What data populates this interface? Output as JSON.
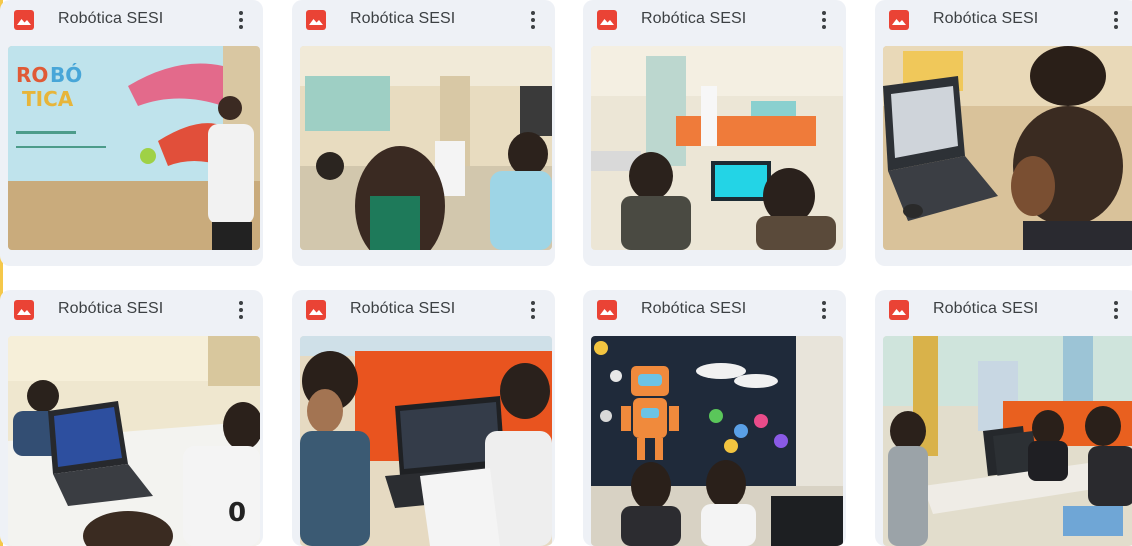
{
  "files": [
    {
      "title": "Robótica SESI",
      "menu_icon": "more-vert-icon",
      "type_icon": "image-file-icon",
      "scene": "presenter-projection"
    },
    {
      "title": "Robótica SESI",
      "menu_icon": "more-vert-icon",
      "type_icon": "image-file-icon",
      "scene": "audience-room"
    },
    {
      "title": "Robótica SESI",
      "menu_icon": "more-vert-icon",
      "type_icon": "image-file-icon",
      "scene": "students-laptops-room"
    },
    {
      "title": "Robótica SESI",
      "menu_icon": "more-vert-icon",
      "type_icon": "image-file-icon",
      "scene": "student-closeup-laptop"
    },
    {
      "title": "Robótica SESI",
      "menu_icon": "more-vert-icon",
      "type_icon": "image-file-icon",
      "scene": "kids-at-table-laptop"
    },
    {
      "title": "Robótica SESI",
      "menu_icon": "more-vert-icon",
      "type_icon": "image-file-icon",
      "scene": "boys-orange-wall"
    },
    {
      "title": "Robótica SESI",
      "menu_icon": "more-vert-icon",
      "type_icon": "image-file-icon",
      "scene": "robot-board-girls"
    },
    {
      "title": "Robótica SESI",
      "menu_icon": "more-vert-icon",
      "type_icon": "image-file-icon",
      "scene": "kids-laptops-orange-wall"
    }
  ],
  "colors": {
    "card_bg": "#eef1f6",
    "icon_red": "#ea4335",
    "title_text": "#3c4043",
    "accent_left": "#f5c84a"
  }
}
